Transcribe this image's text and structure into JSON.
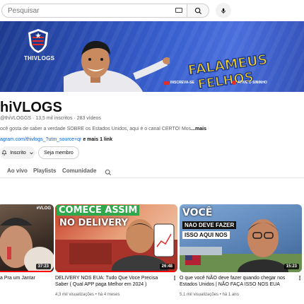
{
  "search": {
    "placeholder": "Pesquisar"
  },
  "banner": {
    "logo_text": "THIVLOGS",
    "title_line1": "FALAMEUS",
    "title_line2": "FELHOS",
    "cta_subscribe": "INSCREVA-SE",
    "cta_bell": "ATIVE O SININHO",
    "colors": {
      "bg": "#2c4fb5",
      "title": "#f5d020",
      "red": "#e52d27"
    }
  },
  "channel": {
    "name": "hiVLOGS",
    "handle": "@thiVLOGGS",
    "subscribers": "13,5 mil inscritos",
    "videos": "283 vídeos",
    "description": "ocê gosta de saber a verdade SOBRE os Estados Unidos, aqui é o canal CERTO! Mos",
    "description_more": "...mais",
    "link_url": "agram.com/thivlogs_?utm_source+qr",
    "link_more": "e mais 1 link",
    "subscribed_label": "Inscrito",
    "join_label": "Seja membro"
  },
  "tabs": {
    "live": "Ao vivo",
    "playlists": "Playlists",
    "community": "Comunidade"
  },
  "videos": [
    {
      "thumb_tag": "#VLOG",
      "duration": "37:23",
      "title": "a Pra um Jantar",
      "meta": "",
      "progress": 1.0
    },
    {
      "thumb_line1": "COMECE ASSIM",
      "thumb_line2": "NO DELIVERY",
      "duration": "26:48",
      "title": "DELIVERY NOS EUA: Tudo Que Voce Precisa Saber ( Qual APP paga Melhor em 2024 )",
      "views": "4,3 mil visualizações",
      "age": "há 4 meses",
      "progress": 1.0
    },
    {
      "thumb_line1": "VOCÊ",
      "thumb_line2": "NAO DEVE FAZER",
      "thumb_line3": "ISSO AQUI NOS",
      "duration": "15:23",
      "title": "O que você NÃO deve fazer quando chegar nos Estados Unidos | NÃO FAÇA ISSO NOS EUA",
      "views": "5,1 mil visualizações",
      "age": "há 1 ano",
      "progress": 0.0
    }
  ]
}
